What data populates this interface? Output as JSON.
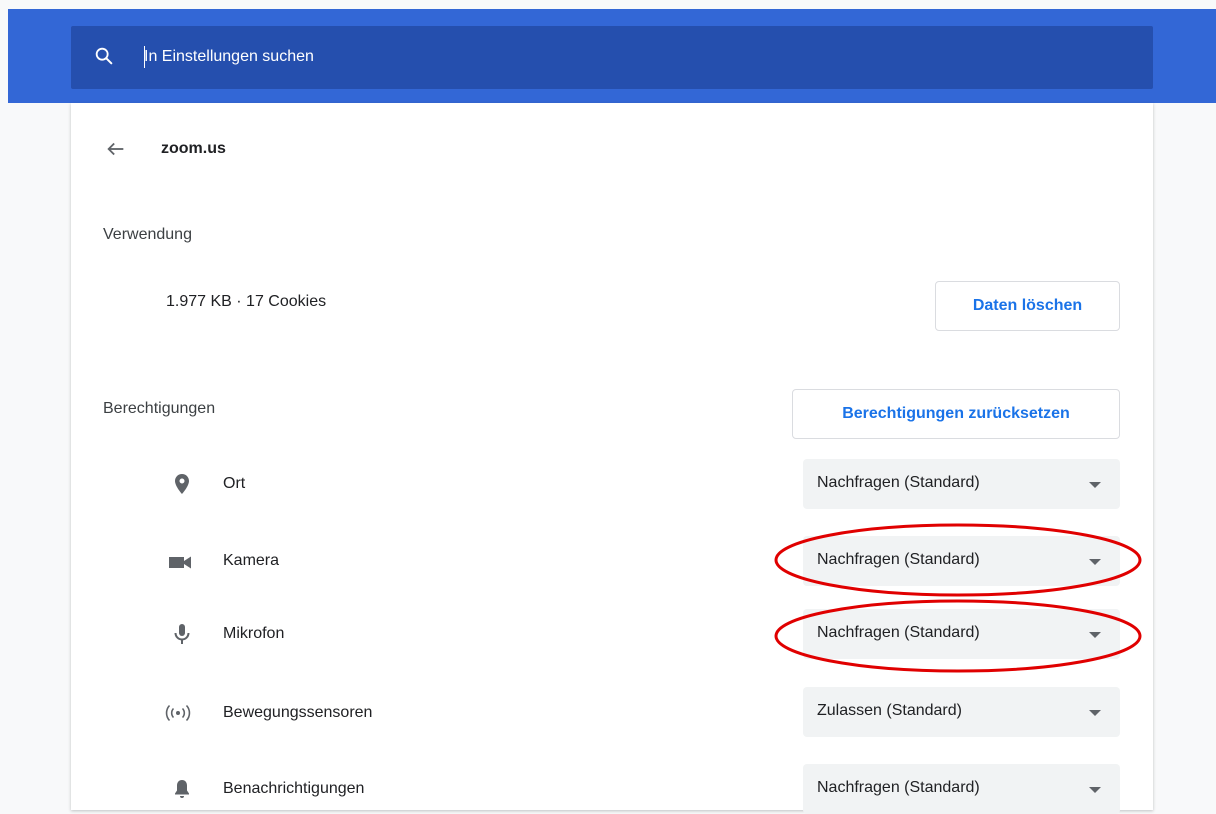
{
  "search": {
    "placeholder": "In Einstellungen suchen",
    "value": "",
    "icon": "search-icon"
  },
  "header": {
    "back_icon": "arrow-back-icon",
    "site": "zoom.us"
  },
  "usage": {
    "label": "Verwendung",
    "summary": "1.977 KB · 17 Cookies",
    "clear_button": "Daten löschen"
  },
  "permissions": {
    "label": "Berechtigungen",
    "reset_button": "Berechtigungen zurücksetzen",
    "items": [
      {
        "icon": "location-pin-icon",
        "label": "Ort",
        "value": "Nachfragen (Standard)"
      },
      {
        "icon": "camera-icon",
        "label": "Kamera",
        "value": "Nachfragen (Standard)"
      },
      {
        "icon": "microphone-icon",
        "label": "Mikrofon",
        "value": "Nachfragen (Standard)"
      },
      {
        "icon": "motion-sensors-icon",
        "label": "Bewegungssensoren",
        "value": "Zulassen (Standard)"
      },
      {
        "icon": "notification-bell-icon",
        "label": "Benachrichtigungen",
        "value": "Nachfragen (Standard)"
      }
    ]
  },
  "annotations": {
    "highlighted_items": [
      "Kamera",
      "Mikrofon"
    ],
    "color": "#e00000"
  },
  "colors": {
    "header_blue": "#3367d6",
    "search_blue": "#254fae",
    "accent": "#1a73e8",
    "page_bg": "#f8f9fa"
  }
}
